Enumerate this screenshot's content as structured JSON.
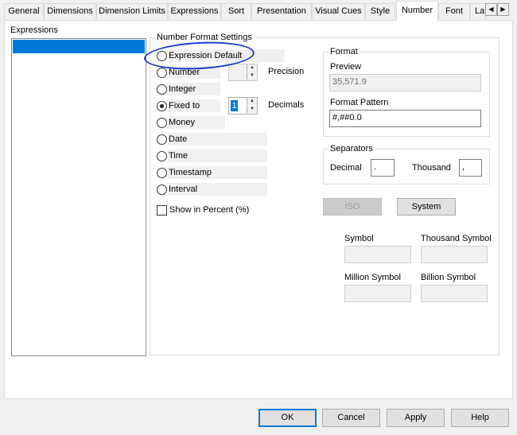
{
  "tabs": [
    "General",
    "Dimensions",
    "Dimension Limits",
    "Expressions",
    "Sort",
    "Presentation",
    "Visual Cues",
    "Style",
    "Number",
    "Font",
    "La"
  ],
  "active_tab": "Number",
  "tab_scroll": {
    "left": "◀",
    "right": "▶"
  },
  "expressions": {
    "label": "Expressions"
  },
  "number_format": {
    "title": "Number Format Settings",
    "options": [
      "Expression Default",
      "Number",
      "Integer",
      "Fixed to",
      "Money",
      "Date",
      "Time",
      "Timestamp",
      "Interval"
    ],
    "selected": "Fixed to",
    "precision_label": "Precision",
    "precision_value": "",
    "decimals_label": "Decimals",
    "decimals_value": "1",
    "show_in_percent": "Show in Percent (%)",
    "show_in_percent_checked": false
  },
  "format": {
    "title": "Format",
    "preview_label": "Preview",
    "preview_value": "35,571.9",
    "pattern_label": "Format Pattern",
    "pattern_value": "#,##0.0"
  },
  "separators": {
    "title": "Separators",
    "decimal_label": "Decimal",
    "decimal_value": ".",
    "thousand_label": "Thousand",
    "thousand_value": ","
  },
  "buttons": {
    "iso": "ISO",
    "system": "System"
  },
  "symbols": {
    "symbol": "Symbol",
    "thousand_symbol": "Thousand Symbol",
    "million_symbol": "Million Symbol",
    "billion_symbol": "Billion Symbol"
  },
  "footer": {
    "ok": "OK",
    "cancel": "Cancel",
    "apply": "Apply",
    "help": "Help"
  },
  "colors": {
    "selection": "#0078d7",
    "annotation": "#1a3ccf"
  }
}
